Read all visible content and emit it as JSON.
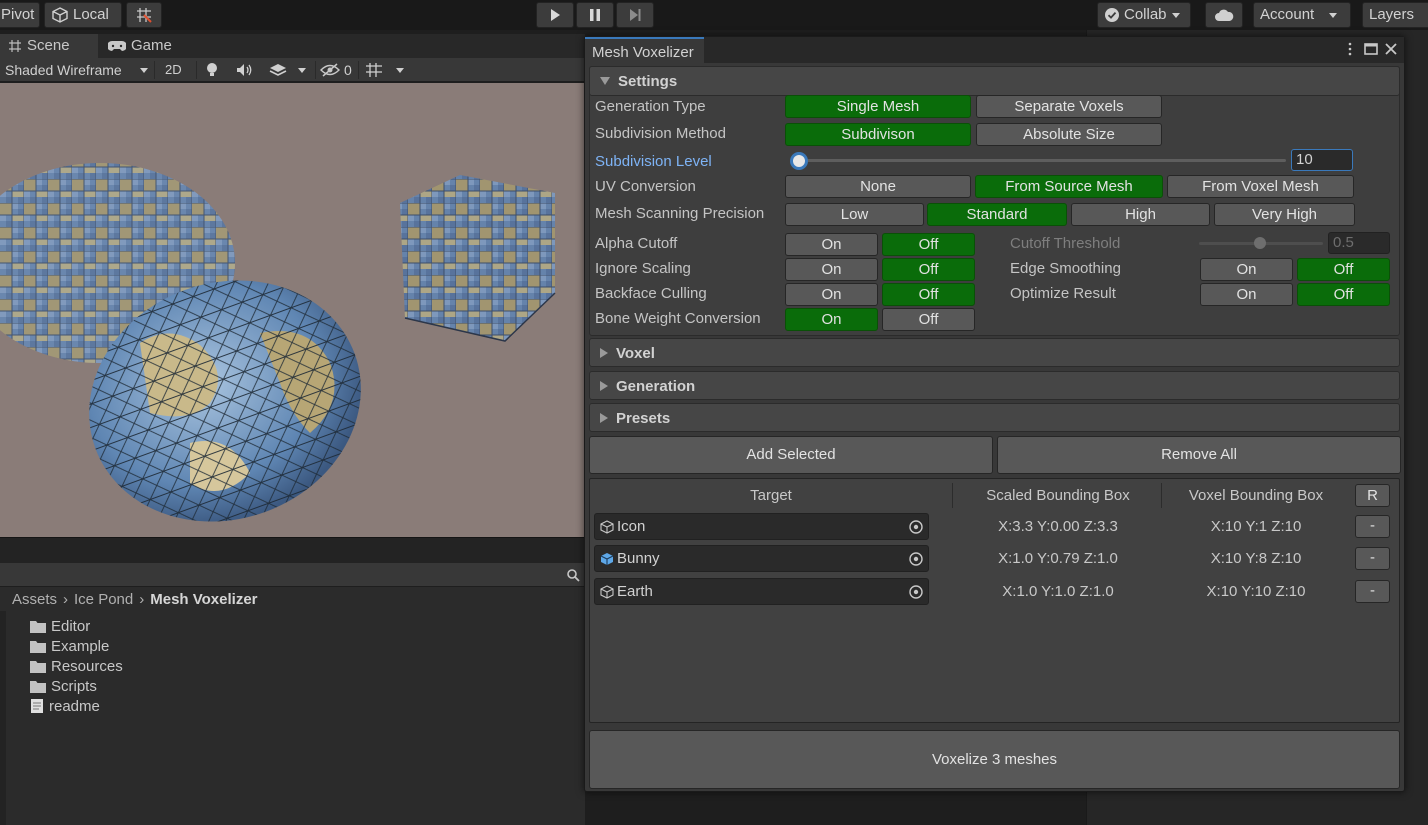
{
  "toolbar": {
    "pivot": "Pivot",
    "local": "Local",
    "collab": "Collab",
    "account": "Account",
    "layers": "Layers"
  },
  "scene": {
    "tab_scene": "Scene",
    "tab_game": "Game",
    "shading_mode": "Shaded Wireframe",
    "mode_2d": "2D",
    "hidden_count": "0"
  },
  "project": {
    "breadcrumb": [
      "Assets",
      "Ice Pond",
      "Mesh Voxelizer"
    ],
    "items": [
      {
        "name": "Editor",
        "icon": "folder-icon"
      },
      {
        "name": "Example",
        "icon": "folder-icon"
      },
      {
        "name": "Resources",
        "icon": "folder-icon"
      },
      {
        "name": "Scripts",
        "icon": "folder-icon"
      },
      {
        "name": "readme",
        "icon": "document-icon"
      }
    ]
  },
  "window": {
    "title": "Mesh Voxelizer",
    "settings": {
      "header": "Settings",
      "generation_type": {
        "label": "Generation Type",
        "options": [
          "Single Mesh",
          "Separate Voxels"
        ],
        "selected": "Single Mesh"
      },
      "subdivision_method": {
        "label": "Subdivision Method",
        "options": [
          "Subdivison",
          "Absolute Size"
        ],
        "selected": "Subdivison"
      },
      "subdivision_level": {
        "label": "Subdivision Level",
        "value": "10"
      },
      "uv_conversion": {
        "label": "UV Conversion",
        "options": [
          "None",
          "From Source Mesh",
          "From Voxel Mesh"
        ],
        "selected": "From Source Mesh"
      },
      "scanning_precision": {
        "label": "Mesh Scanning Precision",
        "options": [
          "Low",
          "Standard",
          "High",
          "Very High"
        ],
        "selected": "Standard"
      },
      "alpha_cutoff": {
        "label": "Alpha Cutoff",
        "on": "On",
        "off": "Off",
        "selected": "Off"
      },
      "ignore_scaling": {
        "label": "Ignore Scaling",
        "on": "On",
        "off": "Off",
        "selected": "Off"
      },
      "backface_culling": {
        "label": "Backface Culling",
        "on": "On",
        "off": "Off",
        "selected": "Off"
      },
      "bone_weight": {
        "label": "Bone Weight Conversion",
        "on": "On",
        "off": "Off",
        "selected": "On"
      },
      "cutoff_threshold": {
        "label": "Cutoff Threshold",
        "value": "0.5"
      },
      "edge_smoothing": {
        "label": "Edge Smoothing",
        "on": "On",
        "off": "Off",
        "selected": "Off"
      },
      "optimize_result": {
        "label": "Optimize Result",
        "on": "On",
        "off": "Off",
        "selected": "Off"
      }
    },
    "foldouts": {
      "voxel": "Voxel",
      "generation": "Generation",
      "presets": "Presets"
    },
    "add_selected": "Add Selected",
    "remove_all": "Remove All",
    "table": {
      "headers": {
        "target": "Target",
        "scaled": "Scaled Bounding Box",
        "voxel": "Voxel Bounding Box",
        "reset": "R"
      },
      "rows": [
        {
          "name": "Icon",
          "scaled": "X:3.3 Y:0.00 Z:3.3",
          "voxel": "X:10 Y:1 Z:10",
          "remove": "-"
        },
        {
          "name": "Bunny",
          "scaled": "X:1.0 Y:0.79 Z:1.0",
          "voxel": "X:10 Y:8 Z:10",
          "remove": "-"
        },
        {
          "name": "Earth",
          "scaled": "X:1.0 Y:1.0 Z:1.0",
          "voxel": "X:10 Y:10 Z:10",
          "remove": "-"
        }
      ]
    },
    "voxelize": "Voxelize 3 meshes"
  }
}
